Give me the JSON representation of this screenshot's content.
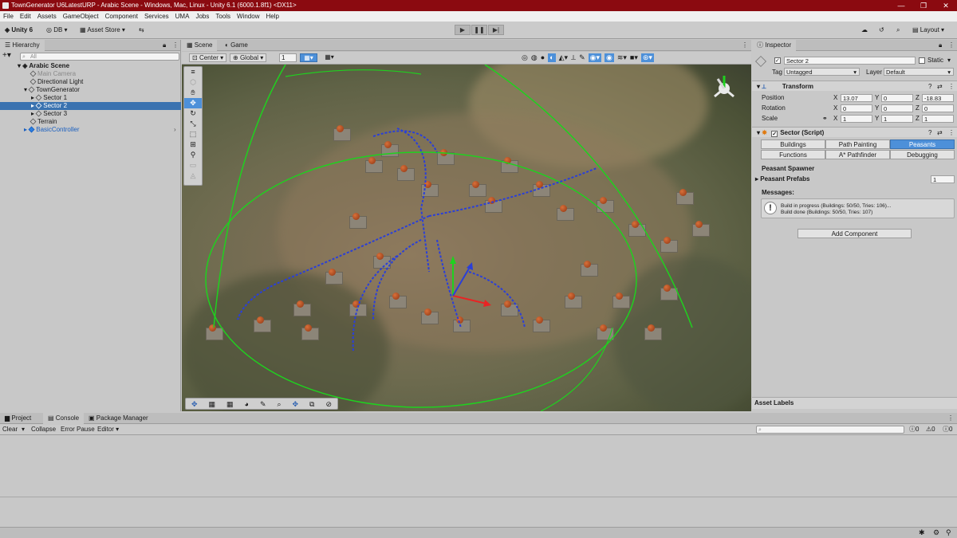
{
  "window": {
    "title": "TownGenerator U6LatestURP - Arabic Scene - Windows, Mac, Linux - Unity 6.1 (6000.1.8f1) <DX11>",
    "controls": {
      "minimize": "—",
      "maximize": "❐",
      "close": "✕"
    }
  },
  "menu": [
    "File",
    "Edit",
    "Assets",
    "GameObject",
    "Component",
    "Services",
    "UMA",
    "Jobs",
    "Tools",
    "Window",
    "Help"
  ],
  "toolbar": {
    "account": "Unity 6",
    "db": "DB",
    "asset_store": "Asset Store",
    "layout": "Layout"
  },
  "hierarchy": {
    "tab": "Hierarchy",
    "search_placeholder": "All",
    "items": [
      {
        "label": "Arabic Scene",
        "type": "scene"
      },
      {
        "label": "Main Camera",
        "type": "disabled"
      },
      {
        "label": "Directional Light",
        "type": "object"
      },
      {
        "label": "TownGenerator",
        "type": "object"
      },
      {
        "label": "Sector 1",
        "type": "object"
      },
      {
        "label": "Sector 2",
        "type": "selected"
      },
      {
        "label": "Sector 3",
        "type": "object"
      },
      {
        "label": "Terrain",
        "type": "object"
      },
      {
        "label": "BasicController",
        "type": "prefab"
      }
    ]
  },
  "scene": {
    "tabs": [
      "Scene",
      "Game"
    ],
    "pivot": "Center",
    "space": "Global",
    "snap_value": "1"
  },
  "inspector": {
    "tab": "Inspector",
    "object_name": "Sector 2",
    "static_label": "Static",
    "tag_label": "Tag",
    "tag_value": "Untagged",
    "layer_label": "Layer",
    "layer_value": "Default",
    "transform": {
      "header": "Transform",
      "position_label": "Position",
      "rotation_label": "Rotation",
      "scale_label": "Scale",
      "position": {
        "x": "13.07",
        "y": "0",
        "z": "-18.83"
      },
      "rotation": {
        "x": "0",
        "y": "0",
        "z": "0"
      },
      "scale": {
        "x": "1",
        "y": "1",
        "z": "1"
      }
    },
    "sector_script": {
      "header": "Sector (Script)",
      "buttons_row1": [
        "Buildings",
        "Path Painting",
        "Peasants"
      ],
      "buttons_row2": [
        "Functions",
        "A* Pathfinder",
        "Debugging"
      ],
      "spawner_label": "Peasant Spawner",
      "prefabs_label": "Peasant Prefabs",
      "prefabs_count": "1",
      "messages_label": "Messages:",
      "message_line1": "Build in progress (Buildings: 50/50, Tries: 106)...",
      "message_line2": "Build done (Buildings: 50/50, Tries: 107)"
    },
    "add_component": "Add Component",
    "asset_labels": "Asset Labels"
  },
  "bottom": {
    "tabs": [
      "Project",
      "Console",
      "Package Manager"
    ],
    "console_buttons": [
      "Clear",
      "Collapse",
      "Error Pause",
      "Editor"
    ],
    "counts": {
      "info": "0",
      "warn": "0",
      "error": "0"
    }
  },
  "colors": {
    "titlebar": "#8b0a10",
    "selection": "#3a72b0",
    "toggle_on": "#4d90d9",
    "gizmo_green": "#1fd11f",
    "path_blue": "#2a3fd8"
  }
}
